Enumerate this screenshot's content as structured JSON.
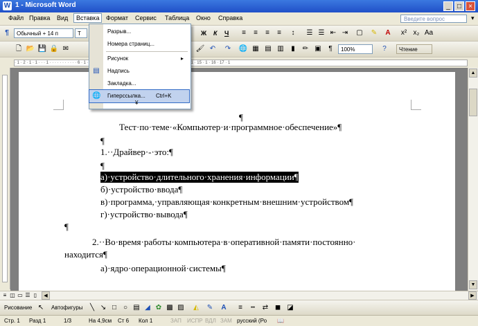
{
  "window": {
    "title": "1 - Microsoft Word",
    "app_icon": "W",
    "min": "_",
    "max": "□",
    "close": "×"
  },
  "menubar": {
    "items": [
      "Файл",
      "Правка",
      "Вид",
      "Вставка",
      "Формат",
      "Сервис",
      "Таблица",
      "Окно",
      "Справка"
    ],
    "help_placeholder": "Введите вопрос",
    "help_arrow": "▾"
  },
  "toolbar_format": {
    "style": "Обычный + 14 п",
    "font": "Т",
    "bold": "Ж",
    "italic": "К",
    "underline": "Ч"
  },
  "toolbar_standard": {
    "zoom": "100%",
    "reading": "Чтение"
  },
  "dropdown": {
    "items": [
      {
        "label": "Разрыв...",
        "shortcut": "",
        "icon": ""
      },
      {
        "label": "Номера страниц...",
        "shortcut": "",
        "icon": ""
      },
      {
        "label": "Рисунок",
        "shortcut": "",
        "icon": "",
        "submenu": "▸"
      },
      {
        "label": "Надпись",
        "shortcut": "",
        "icon": "textbox-icon"
      },
      {
        "label": "Закладка...",
        "shortcut": "",
        "icon": ""
      },
      {
        "label": "Гиперссылка...",
        "shortcut": "Ctrl+K",
        "icon": "hyperlink-icon"
      }
    ],
    "expand": "¥"
  },
  "document": {
    "lines": [
      {
        "text": "¶",
        "hl": false
      },
      {
        "text": "Тест·по·теме·«Компьютер·и·программное·обеспечение»¶",
        "hl": false
      },
      {
        "text": "¶",
        "hl": false
      },
      {
        "text": "1.··Драйвер·-·это:¶",
        "hl": false
      },
      {
        "text": "¶",
        "hl": false
      },
      {
        "text": "а)·устройство·длительного·хранения·информации¶",
        "hl": true
      },
      {
        "text": "б)·устройство·ввода¶",
        "hl": false
      },
      {
        "text": "в)·программа,·управляющая·конкретным·внешним·устройством¶",
        "hl": false
      },
      {
        "text": "г)·устройство·вывода¶",
        "hl": false
      },
      {
        "text": "¶",
        "hl": false
      },
      {
        "text": "2.··Во·время·работы·компьютера·в·оперативной·памяти·постоянно·",
        "hl": false
      },
      {
        "text": "находится¶",
        "hl": false
      },
      {
        "text": "а)·ядро·операционной·системы¶",
        "hl": false
      }
    ]
  },
  "ruler": {
    "ticks": "· 1 · 2 · 1 · 1 · · · 1 · · · · · · · · · · · 6 · 1 · 7 · 1 · 8 · 1 · 9 · 1 · 10 · 1 · 11 · 1 · 12 · 1 · 13 · 1 · 14 · 1 · 15 · 1 · 16 · 17 · 1"
  },
  "drawbar": {
    "drawing": "Рисование",
    "autoshapes": "Автофигуры"
  },
  "status": {
    "page": "Стр. 1",
    "section": "Разд 1",
    "pages": "1/3",
    "at": "На 4,9см",
    "line": "Ст 6",
    "col": "Кол 1",
    "rec": "ЗАП",
    "trk": "ИСПР",
    "ext": "ВДЛ",
    "ovr": "ЗАМ",
    "lang": "русский (Ро",
    "spell": "📖"
  },
  "colors": {
    "title_blue": "#2050c8",
    "highlight": "#c1d2ee"
  }
}
